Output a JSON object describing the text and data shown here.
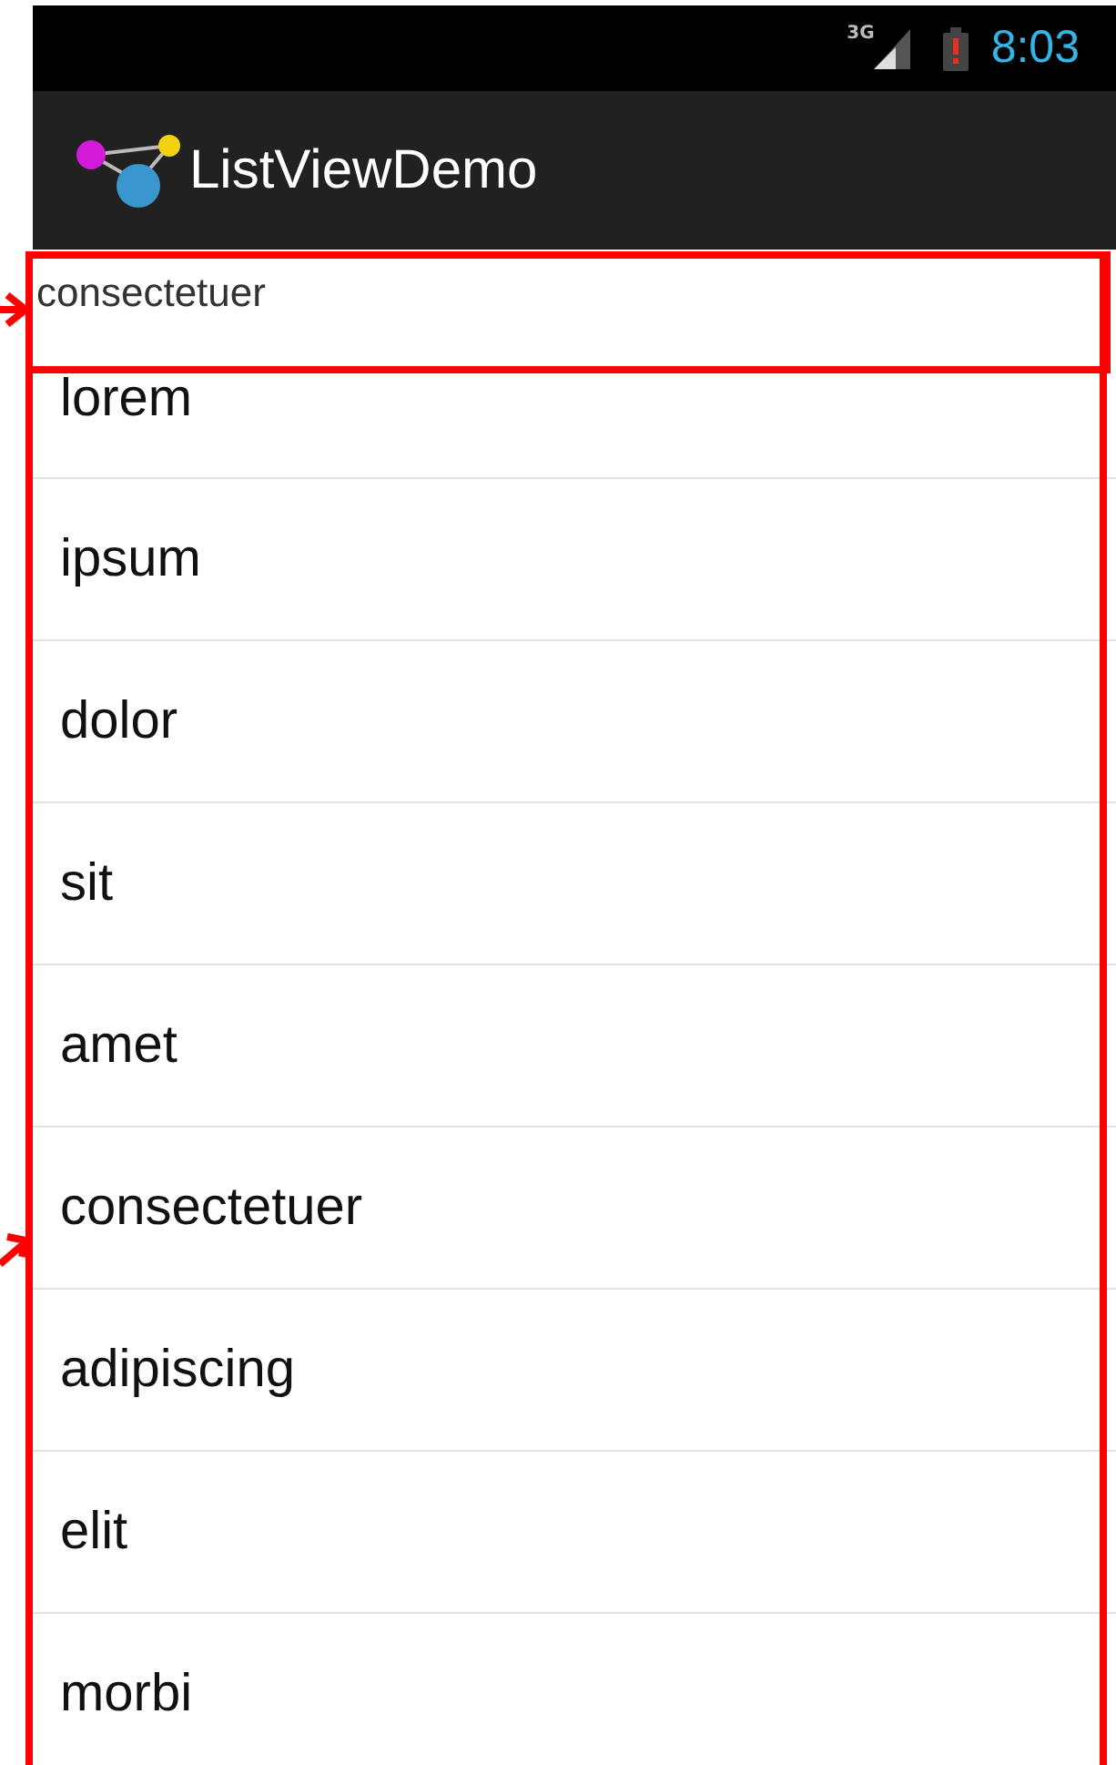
{
  "status_bar": {
    "network": "3G",
    "time": "8:03"
  },
  "action_bar": {
    "title": "ListViewDemo"
  },
  "pinned_header": {
    "label": "consectetuer"
  },
  "list": {
    "items": [
      {
        "label": "lorem"
      },
      {
        "label": "ipsum"
      },
      {
        "label": "dolor"
      },
      {
        "label": "sit"
      },
      {
        "label": "amet"
      },
      {
        "label": "consectetuer"
      },
      {
        "label": "adipiscing"
      },
      {
        "label": "elit"
      },
      {
        "label": "morbi"
      }
    ]
  }
}
